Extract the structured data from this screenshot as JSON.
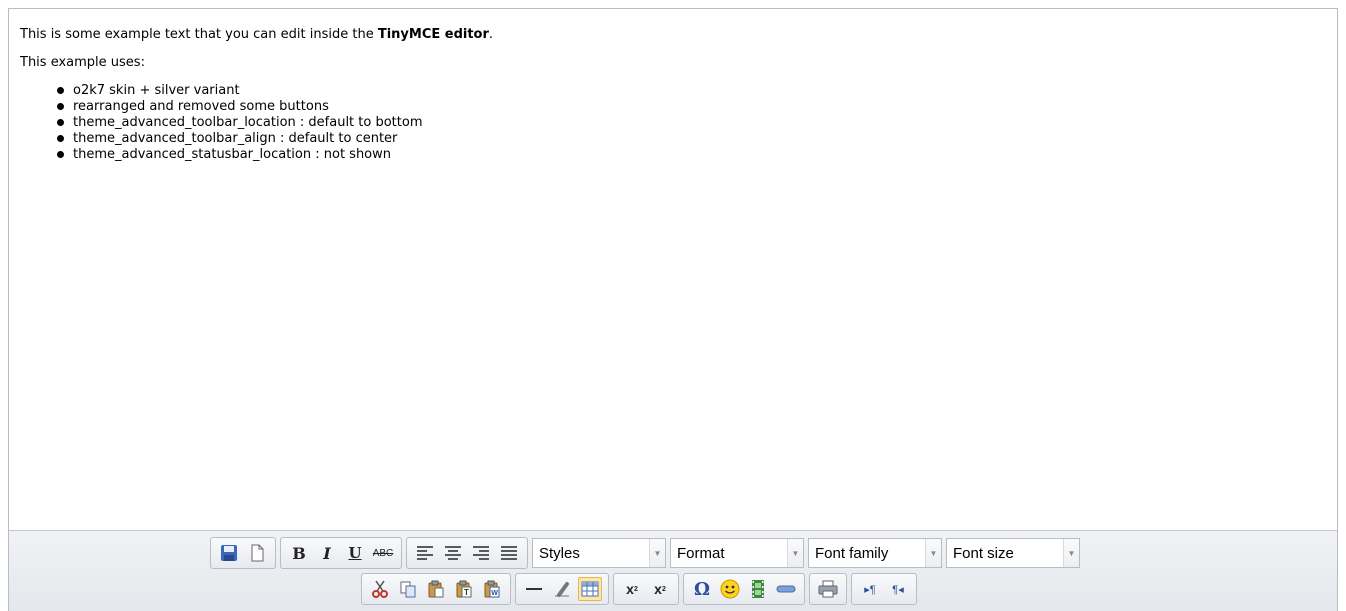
{
  "content": {
    "para1": {
      "prefix": "This is some example text that you can edit inside the ",
      "bold": "TinyMCE editor",
      "suffix": "."
    },
    "para2": "This example uses:",
    "list": [
      "o2k7 skin + silver variant",
      "rearranged and removed some buttons",
      "theme_advanced_toolbar_location : default to bottom",
      "theme_advanced_toolbar_align : default to center",
      "theme_advanced_statusbar_location : not shown"
    ]
  },
  "toolbar": {
    "styles_label": "Styles",
    "format_label": "Format",
    "fontfamily_label": "Font family",
    "fontsize_label": "Font size",
    "bold_glyph": "B",
    "italic_glyph": "I",
    "underline_glyph": "U",
    "strike_glyph": "ABC",
    "subscript_glyph": "x",
    "superscript_glyph": "x",
    "sub_mark": "2",
    "sup_mark": "2",
    "charmap_glyph": "Ω",
    "ltr_glyph": "▸¶",
    "rtl_glyph": "¶◂"
  },
  "icons": [
    "save-icon",
    "new-document-icon",
    "cut-icon",
    "copy-icon",
    "paste-icon",
    "paste-text-icon",
    "paste-word-icon",
    "horizontal-rule-icon",
    "remove-format-icon",
    "table-icon",
    "charmap-icon",
    "emotions-icon",
    "media-icon",
    "advhr-icon",
    "print-icon",
    "ltr-icon",
    "rtl-icon"
  ],
  "colors": {
    "border": "#b9bcc3",
    "toolbar_bg": "#e9ecef",
    "active_button": "#ffe6a6"
  }
}
